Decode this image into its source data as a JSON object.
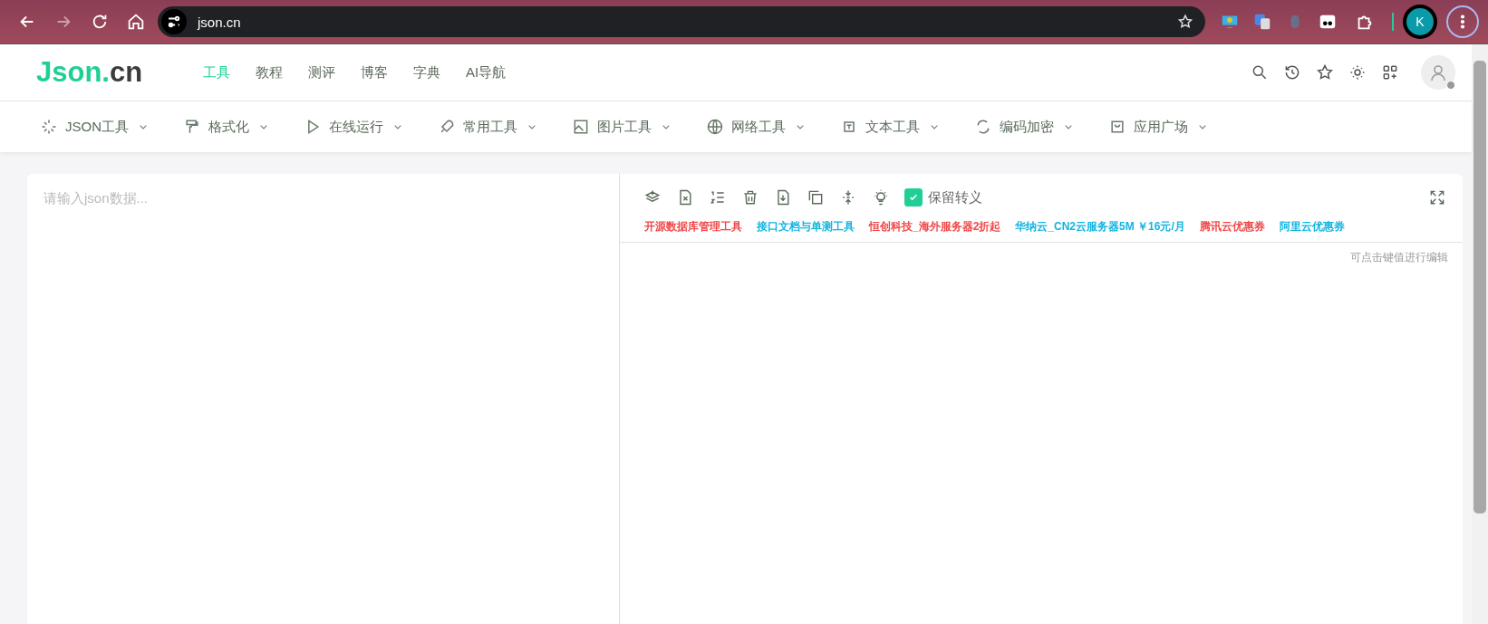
{
  "browser": {
    "url": "json.cn",
    "profile_initial": "K"
  },
  "site": {
    "logo": {
      "accent": "Json.",
      "rest": "cn"
    },
    "nav_links": [
      {
        "label": "工具",
        "selected": true
      },
      {
        "label": "教程",
        "selected": false
      },
      {
        "label": "测评",
        "selected": false
      },
      {
        "label": "博客",
        "selected": false
      },
      {
        "label": "字典",
        "selected": false
      },
      {
        "label": "AI导航",
        "selected": false
      }
    ],
    "tool_menu": [
      {
        "label": "JSON工具"
      },
      {
        "label": "格式化"
      },
      {
        "label": "在线运行"
      },
      {
        "label": "常用工具"
      },
      {
        "label": "图片工具"
      },
      {
        "label": "网络工具"
      },
      {
        "label": "文本工具"
      },
      {
        "label": "编码加密"
      },
      {
        "label": "应用广场"
      }
    ]
  },
  "editor": {
    "placeholder": "请输入json数据..."
  },
  "viewer": {
    "escape_option": {
      "label": "保留转义",
      "checked": true
    },
    "ads": [
      {
        "label": "开源数据库管理工具",
        "color": "#f04848"
      },
      {
        "label": "接口文档与单测工具",
        "color": "#12b5e0"
      },
      {
        "label": "恒创科技_海外服务器2折起",
        "color": "#f04848"
      },
      {
        "label": "华纳云_CN2云服务器5M ￥16元/月",
        "color": "#12b5e0"
      },
      {
        "label": "腾讯云优惠券",
        "color": "#f04848"
      },
      {
        "label": "阿里云优惠券",
        "color": "#12b5e0"
      }
    ],
    "hint": "可点击键值进行编辑"
  }
}
